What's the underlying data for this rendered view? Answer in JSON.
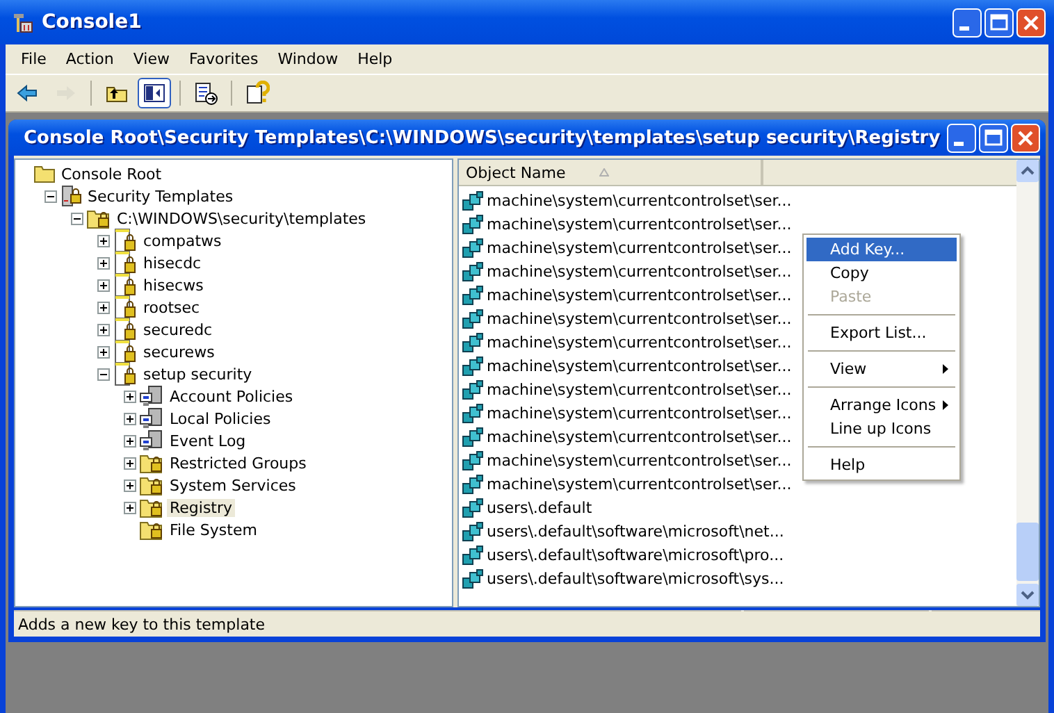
{
  "window": {
    "title": "Console1"
  },
  "menu": [
    {
      "label": "File"
    },
    {
      "label": "Action"
    },
    {
      "label": "View"
    },
    {
      "label": "Favorites"
    },
    {
      "label": "Window"
    },
    {
      "label": "Help"
    }
  ],
  "toolbar": [
    {
      "kind": "back",
      "disabled": false,
      "pressed": false
    },
    {
      "kind": "forward",
      "disabled": true,
      "pressed": false
    },
    {
      "kind": "separator"
    },
    {
      "kind": "up",
      "disabled": false,
      "pressed": false
    },
    {
      "kind": "tree",
      "disabled": false,
      "pressed": true
    },
    {
      "kind": "separator"
    },
    {
      "kind": "export",
      "disabled": false,
      "pressed": false
    },
    {
      "kind": "separator"
    },
    {
      "kind": "help",
      "disabled": false,
      "pressed": false
    }
  ],
  "child_window": {
    "title": "Console Root\\Security Templates\\C:\\WINDOWS\\security\\templates\\setup security\\Registry"
  },
  "tree": [
    {
      "label": "Console Root",
      "kind": "folder",
      "selected": false,
      "children": [
        {
          "label": "Security Templates",
          "kind": "server",
          "selected": false,
          "expanded": true,
          "children": [
            {
              "label": "C:\\WINDOWS\\security\\templates",
              "kind": "lockfolder",
              "selected": false,
              "expanded": true,
              "children": [
                {
                  "label": "compatws",
                  "kind": "template",
                  "selected": false,
                  "expanded": false
                },
                {
                  "label": "hisecdc",
                  "kind": "template",
                  "selected": false,
                  "expanded": false
                },
                {
                  "label": "hisecws",
                  "kind": "template",
                  "selected": false,
                  "expanded": false
                },
                {
                  "label": "rootsec",
                  "kind": "template",
                  "selected": false,
                  "expanded": false
                },
                {
                  "label": "securedc",
                  "kind": "template",
                  "selected": false,
                  "expanded": false
                },
                {
                  "label": "securews",
                  "kind": "template",
                  "selected": false,
                  "expanded": false
                },
                {
                  "label": "setup security",
                  "kind": "template",
                  "selected": false,
                  "expanded": true,
                  "children": [
                    {
                      "label": "Account Policies",
                      "kind": "computer",
                      "selected": false,
                      "expanded": false
                    },
                    {
                      "label": "Local Policies",
                      "kind": "computer",
                      "selected": false,
                      "expanded": false
                    },
                    {
                      "label": "Event Log",
                      "kind": "computer",
                      "selected": false,
                      "expanded": false
                    },
                    {
                      "label": "Restricted Groups",
                      "kind": "lockfolder",
                      "selected": false,
                      "expanded": false
                    },
                    {
                      "label": "System Services",
                      "kind": "lockfolder",
                      "selected": false,
                      "expanded": false
                    },
                    {
                      "label": "Registry",
                      "kind": "lockfolder",
                      "selected": true,
                      "expanded": false
                    },
                    {
                      "label": "File System",
                      "kind": "lockfolder",
                      "selected": false
                    }
                  ]
                }
              ]
            }
          ]
        }
      ]
    }
  ],
  "list": {
    "columns": [
      "Object Name"
    ],
    "rows": [
      "machine\\system\\currentcontrolset\\ser...",
      "machine\\system\\currentcontrolset\\ser...",
      "machine\\system\\currentcontrolset\\ser...",
      "machine\\system\\currentcontrolset\\ser...",
      "machine\\system\\currentcontrolset\\ser...",
      "machine\\system\\currentcontrolset\\ser...",
      "machine\\system\\currentcontrolset\\ser...",
      "machine\\system\\currentcontrolset\\ser...",
      "machine\\system\\currentcontrolset\\ser...",
      "machine\\system\\currentcontrolset\\ser...",
      "machine\\system\\currentcontrolset\\ser...",
      "machine\\system\\currentcontrolset\\ser...",
      "machine\\system\\currentcontrolset\\ser...",
      "users\\.default",
      "users\\.default\\software\\microsoft\\net...",
      "users\\.default\\software\\microsoft\\pro...",
      "users\\.default\\software\\microsoft\\sys..."
    ]
  },
  "context_menu": [
    {
      "kind": "item",
      "label": "Add Key...",
      "selected": true,
      "disabled": false,
      "submenu": false
    },
    {
      "kind": "item",
      "label": "Copy",
      "selected": false,
      "disabled": false,
      "submenu": false
    },
    {
      "kind": "item",
      "label": "Paste",
      "selected": false,
      "disabled": true,
      "submenu": false
    },
    {
      "kind": "separator"
    },
    {
      "kind": "item",
      "label": "Export List...",
      "selected": false,
      "disabled": false,
      "submenu": false
    },
    {
      "kind": "separator"
    },
    {
      "kind": "item",
      "label": "View",
      "selected": false,
      "disabled": false,
      "submenu": true
    },
    {
      "kind": "separator"
    },
    {
      "kind": "item",
      "label": "Arrange Icons",
      "selected": false,
      "disabled": false,
      "submenu": true
    },
    {
      "kind": "item",
      "label": "Line up Icons",
      "selected": false,
      "disabled": false,
      "submenu": false
    },
    {
      "kind": "separator"
    },
    {
      "kind": "item",
      "label": "Help",
      "selected": false,
      "disabled": false,
      "submenu": false
    }
  ],
  "status_bar": {
    "text": "Adds a new key to this template"
  }
}
